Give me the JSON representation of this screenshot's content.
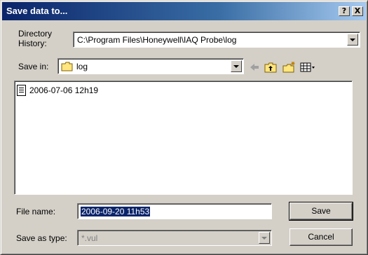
{
  "window": {
    "title": "Save data to...",
    "help_label": "?",
    "close_label": "X"
  },
  "directory_history": {
    "label_line1": "Directory",
    "label_line2": "History:",
    "value": "C:\\Program Files\\Honeywell\\IAQ Probe\\log"
  },
  "save_in": {
    "label": "Save in:",
    "value": "log"
  },
  "toolbar": {
    "icons": [
      "back-arrow-icon",
      "up-folder-icon",
      "new-folder-icon",
      "view-menu-icon"
    ]
  },
  "files": [
    {
      "name": "2006-07-06 12h19",
      "icon": "document-icon"
    }
  ],
  "file_name": {
    "label": "File name:",
    "value": "2006-09-20 11h53"
  },
  "save_as_type": {
    "label": "Save as type:",
    "value": "*.vul"
  },
  "buttons": {
    "save": "Save",
    "cancel": "Cancel"
  }
}
